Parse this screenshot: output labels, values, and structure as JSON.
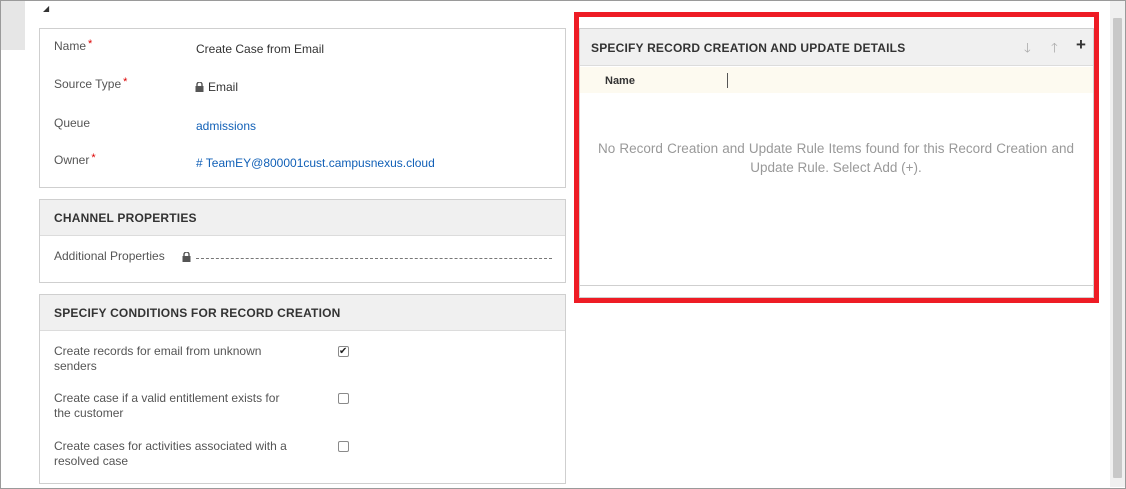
{
  "general": {
    "name_label": "Name",
    "name_value": "Create Case from Email",
    "source_type_label": "Source Type",
    "source_type_value": "Email",
    "queue_label": "Queue",
    "queue_value": "admissions",
    "owner_label": "Owner",
    "owner_value": "# TeamEY@800001cust.campusnexus.cloud",
    "required_marker": "*"
  },
  "channel": {
    "title": "CHANNEL PROPERTIES",
    "additional_label": "Additional Properties"
  },
  "conditions": {
    "title": "SPECIFY CONDITIONS FOR RECORD CREATION",
    "rows": [
      {
        "label": "Create records for email from unknown senders",
        "checked": true
      },
      {
        "label": "Create case if a valid entitlement exists for the customer",
        "checked": false
      },
      {
        "label": "Create cases for activities associated with a resolved case",
        "checked": false
      }
    ]
  },
  "details": {
    "title": "SPECIFY RECORD CREATION AND UPDATE DETAILS",
    "column_name": "Name",
    "empty_message": "No Record Creation and Update Rule Items found for this Record Creation and Update Rule. Select Add (+).",
    "highlight_color": "#ee1c25"
  },
  "icons": {
    "move_down": "arrow-down-icon",
    "move_up": "arrow-up-icon",
    "add": "plus-icon",
    "lock": "lock-icon",
    "collapse": "collapse-triangle-icon"
  }
}
